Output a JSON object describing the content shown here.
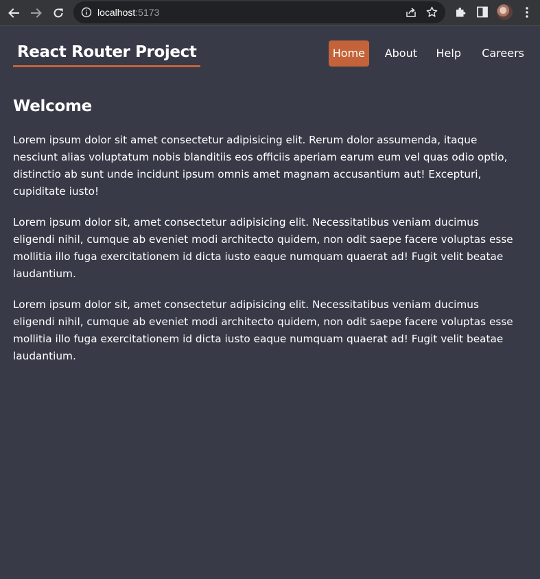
{
  "browser": {
    "url_host": "localhost",
    "url_port": ":5173",
    "icons": {
      "back": "arrow-left-icon",
      "forward": "arrow-right-icon",
      "reload": "reload-icon",
      "info": "info-icon",
      "share": "share-icon",
      "bookmark": "star-icon",
      "extensions": "puzzle-icon",
      "side_panel": "side-panel-icon",
      "menu": "kebab-menu-icon"
    }
  },
  "header": {
    "brand": "React Router Project",
    "nav": [
      {
        "label": "Home",
        "active": true
      },
      {
        "label": "About",
        "active": false
      },
      {
        "label": "Help",
        "active": false
      },
      {
        "label": "Careers",
        "active": false
      }
    ]
  },
  "main": {
    "title": "Welcome",
    "paragraphs": [
      "Lorem ipsum dolor sit amet consectetur adipisicing elit. Rerum dolor assumenda, itaque nesciunt alias voluptatum nobis blanditiis eos officiis aperiam earum eum vel quas odio optio, distinctio ab sunt unde incidunt ipsum omnis amet magnam accusantium aut! Excepturi, cupiditate iusto!",
      "Lorem ipsum dolor sit, amet consectetur adipisicing elit. Necessitatibus veniam ducimus eligendi nihil, cumque ab eveniet modi architecto quidem, non odit saepe facere voluptas esse mollitia illo fuga exercitationem id dicta iusto eaque numquam quaerat ad! Fugit velit beatae laudantium.",
      "Lorem ipsum dolor sit, amet consectetur adipisicing elit. Necessitatibus veniam ducimus eligendi nihil, cumque ab eveniet modi architecto quidem, non odit saepe facere voluptas esse mollitia illo fuga exercitationem id dicta iusto eaque numquam quaerat ad! Fugit velit beatae laudantium."
    ]
  },
  "colors": {
    "background": "#383a47",
    "accent": "#c4633a",
    "chrome": "#35363a",
    "omnibox": "#202124"
  }
}
